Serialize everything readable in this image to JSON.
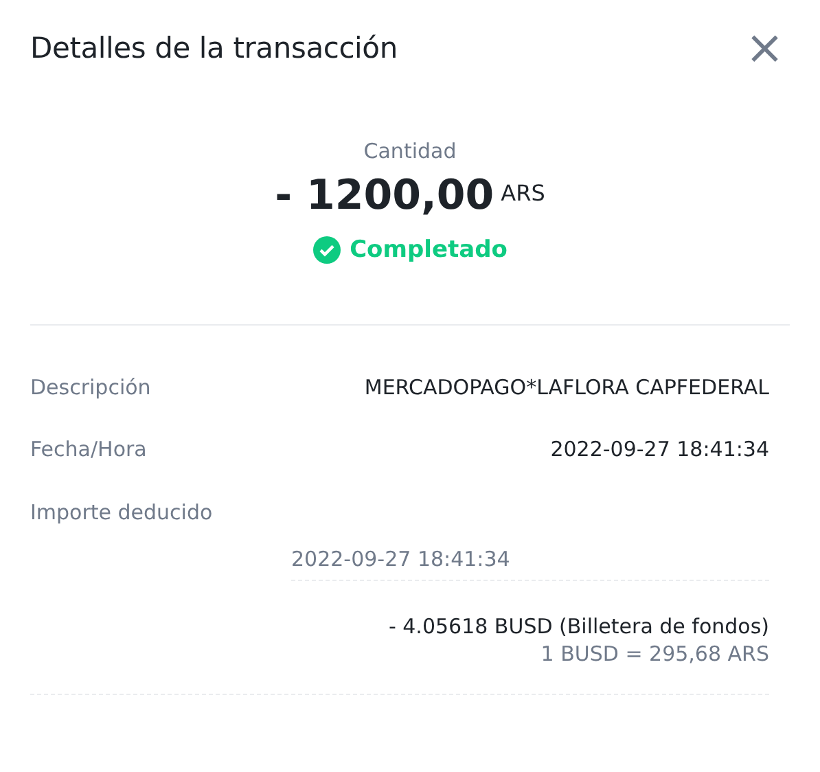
{
  "header": {
    "title": "Detalles de la transacción",
    "close": "×"
  },
  "amount": {
    "label": "Cantidad",
    "value": "- 1200,00",
    "currency": "ARS"
  },
  "status": {
    "kind": "completed",
    "label": "Completado"
  },
  "details": [
    {
      "label": "Descripción",
      "value": "MERCADOPAGO*LAFLORA CAPFEDERAL"
    },
    {
      "label": "Fecha/Hora",
      "value": "2022-09-27 18:41:34"
    },
    {
      "label": "Importe deducido"
    }
  ],
  "deduction": {
    "time": "2022-09-27 18:41:34",
    "amount": "- 4.05618 BUSD (Billetera de fondos)",
    "rate": "1 BUSD = 295,68 ARS"
  }
}
